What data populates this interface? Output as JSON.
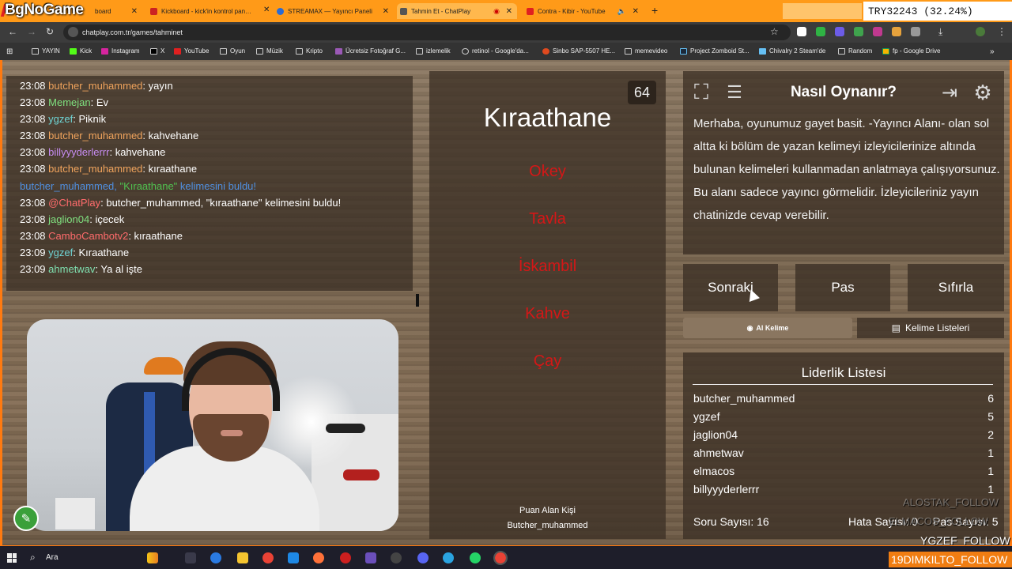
{
  "overlay_brand": "BgNoGame",
  "tabs": [
    {
      "title": "board",
      "x": 0
    },
    {
      "title": "Kickboard - kick'in kontrol pan…",
      "x": 1
    },
    {
      "title": "STREAMAX — Yayıncı Paneli",
      "x": 2
    },
    {
      "title": "Tahmin Et - ChatPlay",
      "x": 3
    },
    {
      "title": "Contra - Kibir - YouTube",
      "x": 4
    }
  ],
  "try_box": "TRY32243 (32.24%)",
  "url": "chatplay.com.tr/games/tahminet",
  "bookmarks": [
    "YAYIN",
    "Kick",
    "Instagram",
    "X",
    "YouTube",
    "Oyun",
    "Müzik",
    "Kripto",
    "Ücretsiz Fotoğraf G...",
    "izlemelik",
    "retinol - Google'da...",
    "Sinbo SAP-5507 HE...",
    "memevideo",
    "Project Zomboid St...",
    "Chivalry 2 Steam'de",
    "Random",
    "fp - Google Drive"
  ],
  "chat": [
    {
      "time": "23:08",
      "user": "butcher_muhammed",
      "msg": ": yayın",
      "color": "#f0a35c"
    },
    {
      "time": "23:08",
      "user": "Memejan",
      "msg": ": Ev",
      "color": "#7fe07f"
    },
    {
      "time": "23:08",
      "user": "ygzef",
      "msg": ": Piknik",
      "color": "#6fd5d5"
    },
    {
      "time": "23:08",
      "user": "butcher_muhammed",
      "msg": ": kahvehane",
      "color": "#f0a35c"
    },
    {
      "time": "23:08",
      "user": "billyyyderlerrr",
      "msg": ": kahvehane",
      "color": "#c58bf0"
    },
    {
      "time": "23:08",
      "user": "butcher_muhammed",
      "msg": ": kıraathane",
      "color": "#f0a35c"
    },
    {
      "time": "23:08",
      "user": "@ChatPlay",
      "msg": ": butcher_muhammed, \"kıraathane\" kelimesini buldu!",
      "color": "#ff6b6b"
    },
    {
      "time": "23:08",
      "user": "jaglion04",
      "msg": ": içecek",
      "color": "#7fe07f"
    },
    {
      "time": "23:08",
      "user": "CamboCambotv2",
      "msg": ": kıraathane",
      "color": "#ff6b6b"
    },
    {
      "time": "23:09",
      "user": "ygzef",
      "msg": ": Kıraathane",
      "color": "#6fd5d5"
    },
    {
      "time": "23:09",
      "user": "ahmetwav",
      "msg": ": Ya al işte",
      "color": "#7fe0b0"
    }
  ],
  "chat_system": {
    "user": "butcher_muhammed,",
    "word": "\"Kıraathane\"",
    "rest": " kelimesini buldu!"
  },
  "game": {
    "timer": "64",
    "word": "Kıraathane",
    "taboo_words": [
      "Okey",
      "Tavla",
      "İskambil",
      "Kahve",
      "Çay"
    ],
    "scorer_label": "Puan Alan Kişi",
    "scorer_name": "Butcher_muhammed"
  },
  "howto": {
    "title": "Nasıl Oynanır?",
    "text": "Merhaba, oyunumuz gayet basit. -Yayıncı Alanı- olan sol altta ki bölüm de yazan kelimeyi izleyicilerinize altında bulunan kelimeleri kullanmadan anlatmaya çalışıyorsunuz. Bu alanı sadece yayıncı görmelidir. İzleyicileriniz yayın chatinizde cevap verebilir."
  },
  "controls": {
    "next": "Sonraki",
    "pass": "Pas",
    "reset": "Sıfırla",
    "get_word": "Al Kelime",
    "word_lists": "Kelime Listeleri"
  },
  "leaderboard": {
    "title": "Liderlik Listesi",
    "rows": [
      {
        "name": "butcher_muhammed",
        "score": "6"
      },
      {
        "name": "ygzef",
        "score": "5"
      },
      {
        "name": "jaglion04",
        "score": "2"
      },
      {
        "name": "ahmetwav",
        "score": "1"
      },
      {
        "name": "elmacos",
        "score": "1"
      },
      {
        "name": "billyyyderlerrr",
        "score": "1"
      }
    ],
    "soru": "Soru Sayısı: 16",
    "hata": "Hata Sayısı: 0",
    "pas": "Pas Sayısı: 5"
  },
  "overlays": {
    "follow1": "YGZEF_FOLLOW",
    "follow2": "19DIMKILTO_FOLLOW",
    "faded1": "ALOSTAK_FOLLOW",
    "faded2": "ELMACOS_FOLLOW"
  },
  "taskbar": {
    "search": "Ara"
  },
  "colors": {
    "accent_orange": "#ff9a18",
    "taboo_red": "#d41717",
    "wood": "#7a6751"
  }
}
